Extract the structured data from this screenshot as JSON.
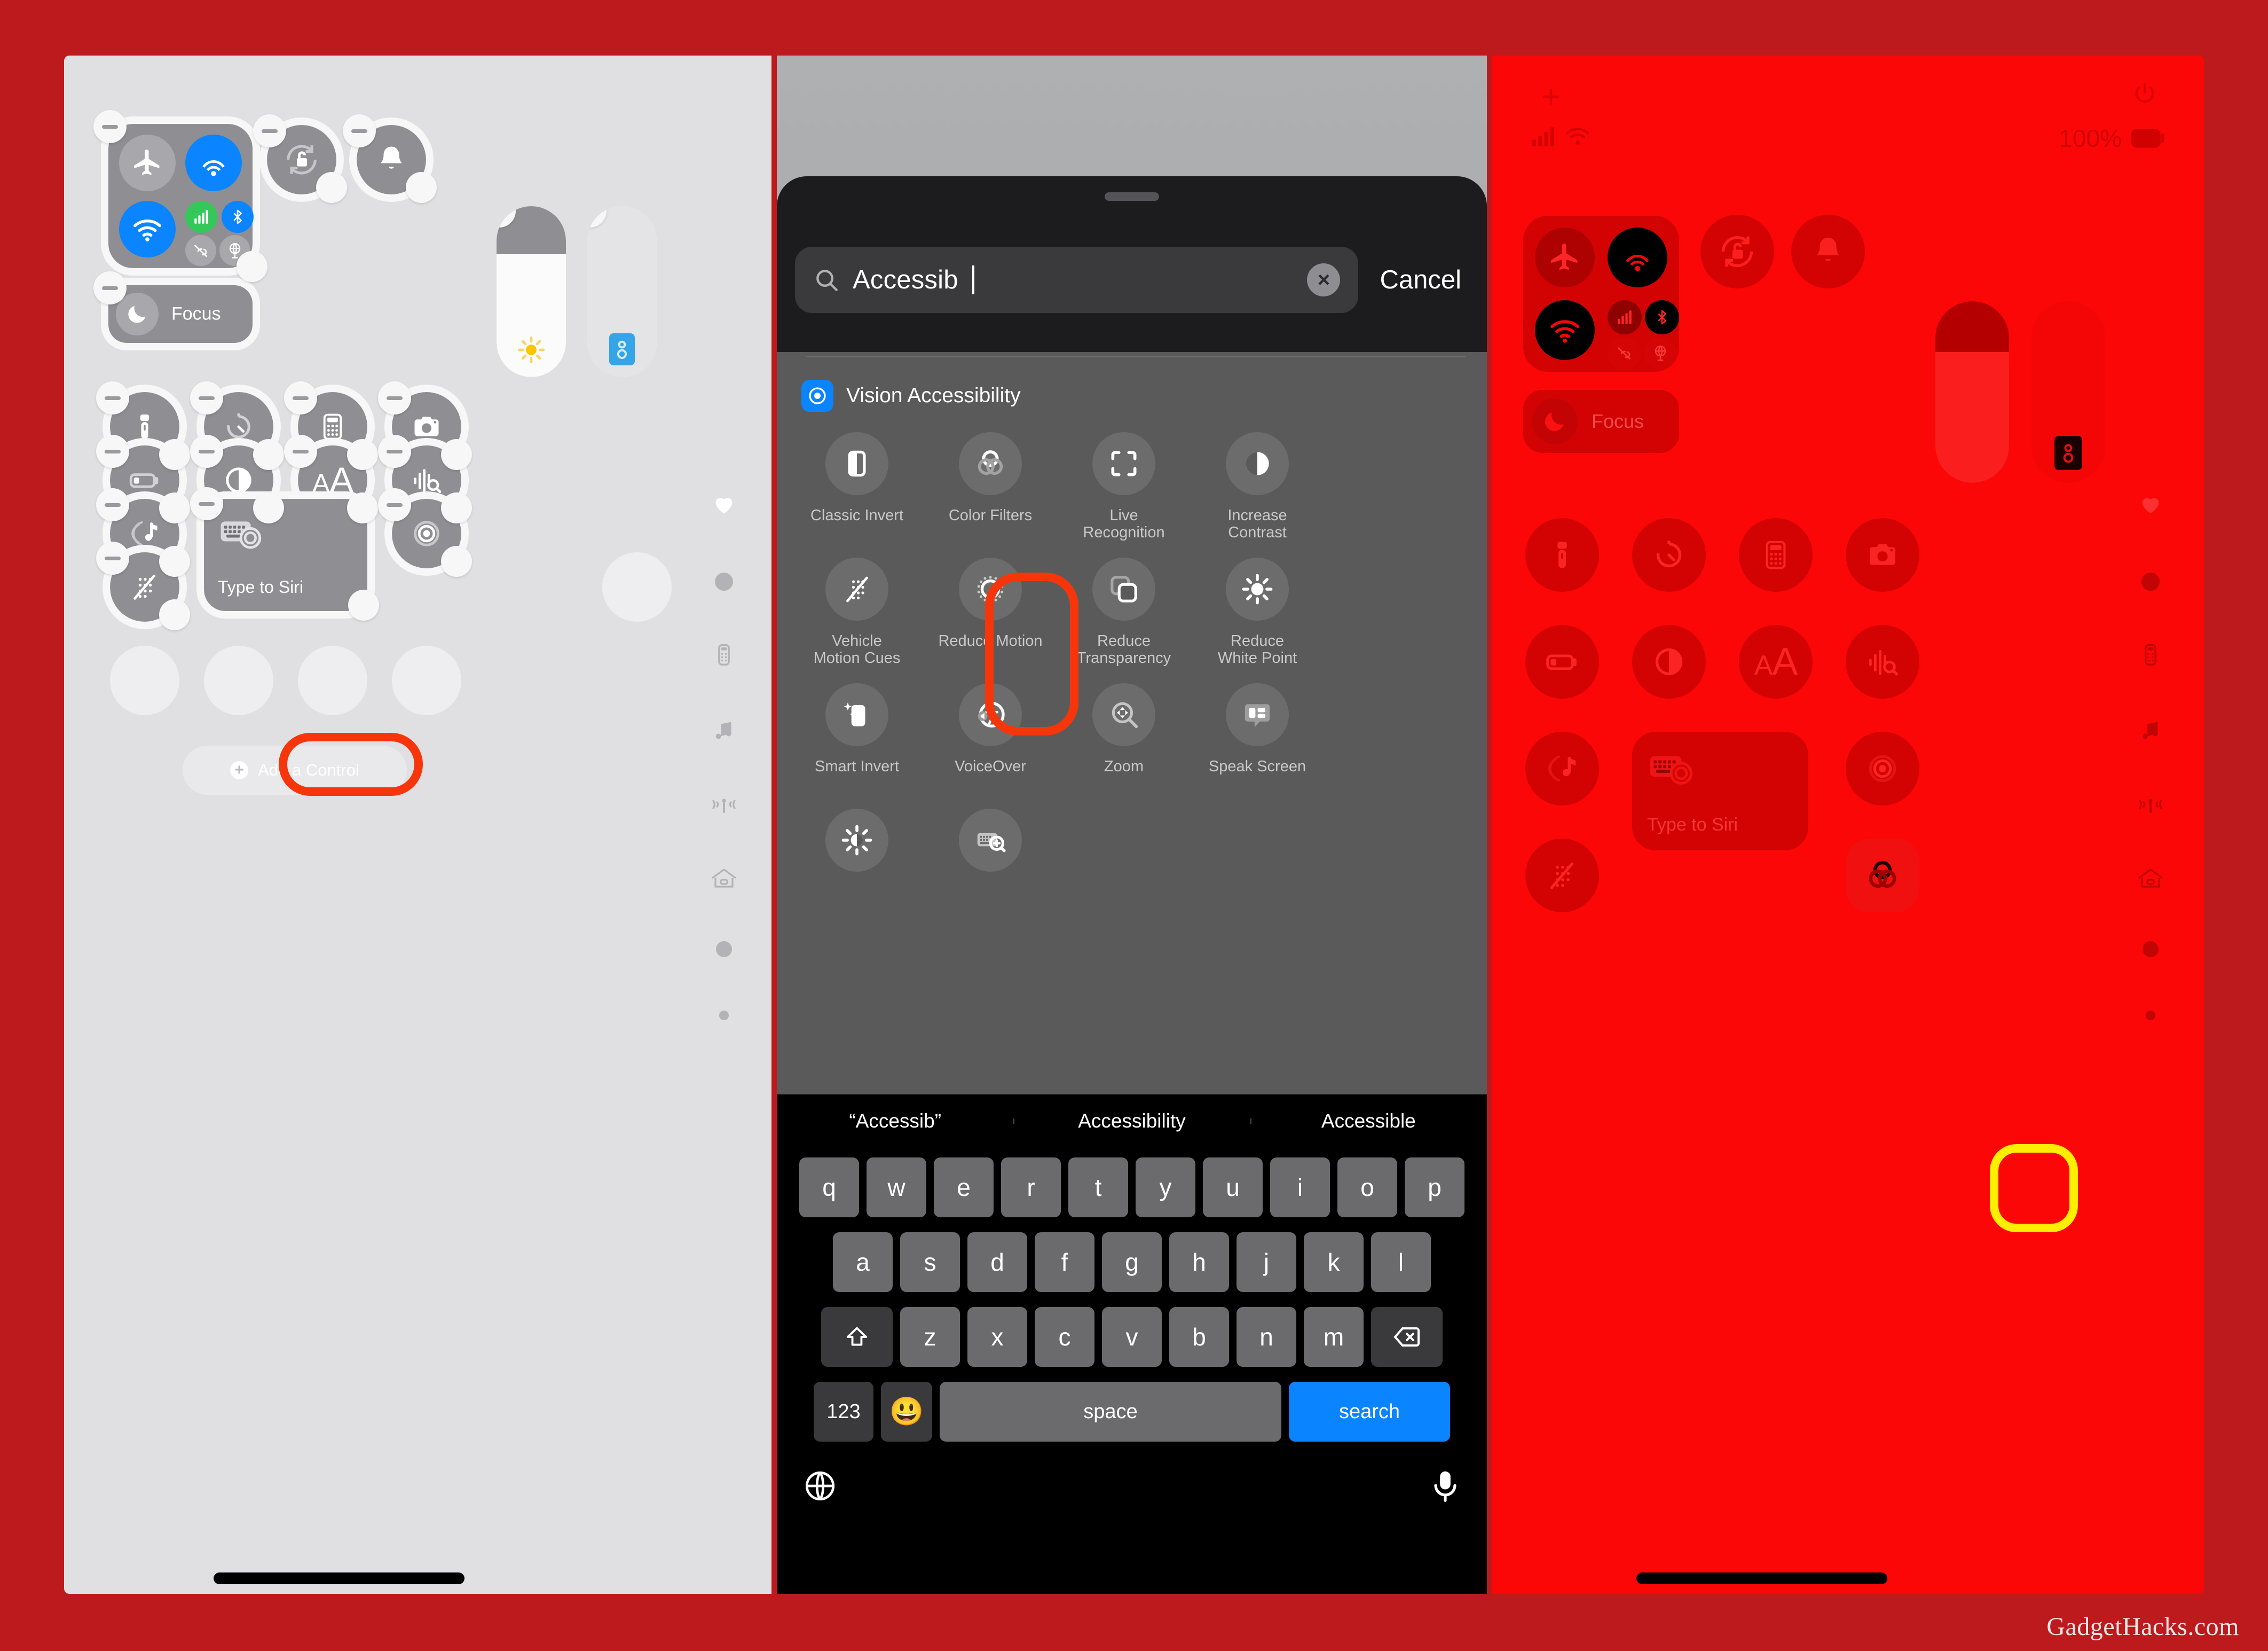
{
  "meta": {
    "watermark": "GadgetHacks.com",
    "accent_red": "#f6360a",
    "accent_yellow": "#ffee00",
    "panel_bg_red": "#fb0707",
    "outer_bg": "#bd1a1e",
    "ios_blue": "#0a84ff"
  },
  "left_panel": {
    "name": "Control Center edit mode",
    "connectivity_group": {
      "airplane_mode": "airplane-icon",
      "airdrop": "airdrop-icon",
      "wifi": "wifi-icon",
      "cellular": "cellular-bars-icon",
      "bluetooth": "bluetooth-icon",
      "personal_hotspot": "hotspot-off-icon",
      "vpn": "vpn-globe-icon"
    },
    "focus_tile": {
      "label": "Focus",
      "icon": "moon-icon"
    },
    "rotation_lock": "rotation-lock-icon",
    "silent_mode": "bell-icon",
    "brightness_slider": {
      "icon": "sun-icon",
      "fill_percent": 72
    },
    "volume_slider": {
      "icon": "speaker-icon",
      "fill_percent": 0
    },
    "controls": [
      {
        "icon": "flashlight-icon",
        "name": "flashlight"
      },
      {
        "icon": "timer-icon",
        "name": "timer"
      },
      {
        "icon": "calculator-icon",
        "name": "calculator"
      },
      {
        "icon": "camera-icon",
        "name": "camera"
      },
      {
        "icon": "low-power-icon",
        "name": "low-power-mode"
      },
      {
        "icon": "dark-mode-icon",
        "name": "dark-mode"
      },
      {
        "icon": "text-size-icon",
        "name": "text-size"
      },
      {
        "icon": "sound-recognition-icon",
        "name": "sound-recognition"
      },
      {
        "icon": "shazam-icon",
        "name": "music-recognition"
      },
      {
        "icon": "type-to-siri-icon",
        "name": "type-to-siri",
        "label": "Type to Siri"
      },
      {
        "icon": "voice-memo-icon",
        "name": "voice-memo"
      },
      {
        "icon": "vehicle-motion-cues-icon",
        "name": "vehicle-motion-cues"
      }
    ],
    "add_control_button": "Add a Control",
    "rail_icons": [
      "heart-icon",
      "dot-icon",
      "remote-icon",
      "music-note-icon",
      "airplay-icon",
      "home-icon",
      "dot-icon",
      "small-dot-icon"
    ]
  },
  "middle_panel": {
    "search": {
      "value": "Accessib",
      "icon": "search-icon",
      "clear_icon": "clear-circle-icon",
      "cancel_label": "Cancel"
    },
    "section": {
      "title": "Vision Accessibility",
      "icon": "eye-icon"
    },
    "results": [
      {
        "label": "Classic Invert",
        "icon": "classic-invert-icon",
        "highlighted": false
      },
      {
        "label": "Color Filters",
        "icon": "color-filters-icon",
        "highlighted": true
      },
      {
        "label": "Live\nRecognition",
        "icon": "live-recognition-icon",
        "highlighted": false
      },
      {
        "label": "Increase\nContrast",
        "icon": "increase-contrast-icon",
        "highlighted": false
      },
      {
        "label": "Vehicle\nMotion Cues",
        "icon": "vehicle-motion-cues-icon",
        "highlighted": false
      },
      {
        "label": "Reduce Motion",
        "icon": "reduce-motion-icon",
        "highlighted": false
      },
      {
        "label": "Reduce\nTransparency",
        "icon": "reduce-transparency-icon",
        "highlighted": false
      },
      {
        "label": "Reduce\nWhite Point",
        "icon": "reduce-white-point-icon",
        "highlighted": false
      },
      {
        "label": "Smart Invert",
        "icon": "smart-invert-icon",
        "highlighted": false
      },
      {
        "label": "VoiceOver",
        "icon": "voiceover-icon",
        "highlighted": false
      },
      {
        "label": "Zoom",
        "icon": "zoom-icon",
        "highlighted": false
      },
      {
        "label": "Speak Screen",
        "icon": "speak-screen-icon",
        "highlighted": false
      },
      {
        "label": "",
        "icon": "brightness-icon",
        "highlighted": false
      },
      {
        "label": "",
        "icon": "hover-text-icon",
        "highlighted": false
      }
    ],
    "keyboard": {
      "suggestions": [
        "“Accessib”",
        "Accessibility",
        "Accessible"
      ],
      "row1": [
        "q",
        "w",
        "e",
        "r",
        "t",
        "y",
        "u",
        "i",
        "o",
        "p"
      ],
      "row2": [
        "a",
        "s",
        "d",
        "f",
        "g",
        "h",
        "j",
        "k",
        "l"
      ],
      "row3": [
        "z",
        "x",
        "c",
        "v",
        "b",
        "n",
        "m"
      ],
      "shift_icon": "shift-icon",
      "backspace_icon": "backspace-icon",
      "numbers_key": "123",
      "emoji_icon": "emoji-icon",
      "space_key": "space",
      "return_key": "search",
      "globe_icon": "globe-icon",
      "mic_icon": "microphone-icon"
    }
  },
  "right_panel": {
    "name": "Control Center with Color Filters applied",
    "status": {
      "battery": "100%",
      "signal_icon": "cellular-bars-icon",
      "wifi_icon": "wifi-icon",
      "power_icon": "power-icon",
      "plus_icon": "plus-icon"
    },
    "focus_tile": {
      "label": "Focus",
      "icon": "moon-icon"
    },
    "siri_tile": {
      "label": "Type to Siri",
      "icon": "type-to-siri-icon"
    },
    "highlighted_control": {
      "label": "Color Filters",
      "icon": "color-filters-icon"
    },
    "rail_icons": [
      "heart-icon",
      "dot-icon",
      "remote-icon",
      "music-note-icon",
      "airplay-icon",
      "home-icon",
      "dot-icon",
      "small-dot-icon"
    ]
  }
}
